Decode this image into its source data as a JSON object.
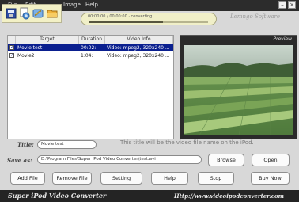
{
  "menu": [
    "File",
    "Edit",
    "Image",
    "Help"
  ],
  "window": {
    "minimize": "–",
    "close": "×"
  },
  "logo_text": "Lemngo Software",
  "toolbar": {
    "icons": [
      "save-icon",
      "convert-icon",
      "edit-icon",
      "open-folder-icon"
    ]
  },
  "status": {
    "text": "00:00:00 / 00:00:00 · converting…",
    "progress": 0.62
  },
  "file_list": {
    "columns": [
      "Target",
      "Duration",
      "Video Info"
    ],
    "rows": [
      {
        "checked": true,
        "selected": true,
        "target": "Movie test",
        "duration": "00:02:",
        "video_info": "Video: mpeg2, 320x240 ..."
      },
      {
        "checked": true,
        "selected": false,
        "target": "Movie2",
        "duration": "1:04:",
        "video_info": "Video: mpeg2, 320x240 ..."
      }
    ]
  },
  "preview": {
    "title": "Preview"
  },
  "form": {
    "title_label": "Title:",
    "title_value": "Movie test",
    "hint": "This title will be the video file name on the iPod.",
    "save_as_label": "Save as:",
    "save_as_value": "D:\\Program Files\\Super iPod Video Converter\\test.avi",
    "browse": "Browse",
    "open": "Open"
  },
  "actions": [
    "Add File",
    "Remove File",
    "Setting",
    "Help",
    "Stop",
    "Buy Now"
  ],
  "footer": {
    "app_name": "Super iPod Video Converter",
    "url": "Http://www.videoipodconverter.com"
  },
  "colors": {
    "selected_row": "#0a1f8f",
    "toolbar_bg": "#f3f1c6",
    "bottom_bar": "#242424"
  }
}
